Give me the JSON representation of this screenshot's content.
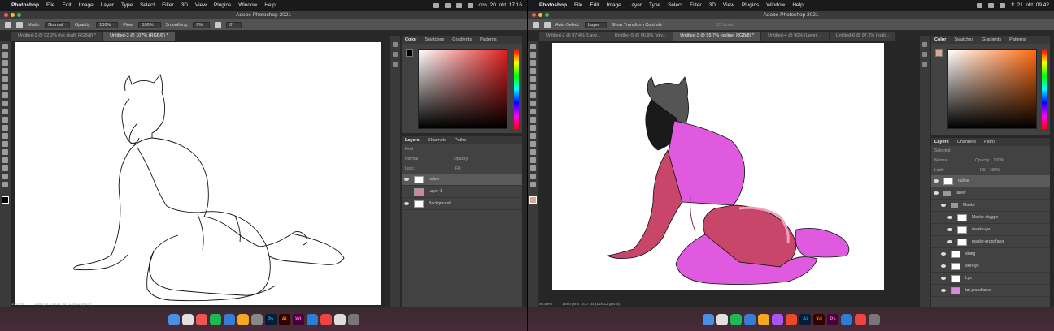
{
  "menu_left": {
    "app": "Photoshop",
    "items": [
      "File",
      "Edit",
      "Image",
      "Layer",
      "Type",
      "Select",
      "Filter",
      "3D",
      "View",
      "Plugins",
      "Window",
      "Help"
    ],
    "clock": "ons. 20. okt. 17.16"
  },
  "menu_right": {
    "app": "Photoshop",
    "items": [
      "File",
      "Edit",
      "Image",
      "Layer",
      "Type",
      "Select",
      "Filter",
      "3D",
      "View",
      "Plugins",
      "Window",
      "Help"
    ],
    "clock": "fr. 21. okt. 09.42"
  },
  "title_left": "Adobe Photoshop 2021",
  "title_right": "Adobe Photoshop 2021",
  "opts_left": {
    "mode_label": "Mode:",
    "mode": "Normal",
    "opacity_label": "Opacity:",
    "opacity": "100%",
    "flow_label": "Flow:",
    "flow": "100%",
    "smoothing_label": "Smoothing:",
    "smoothing": "0%",
    "angle": "0°"
  },
  "opts_right": {
    "auto_select": "Auto-Select:",
    "layer": "Layer",
    "transform": "Show Transform Controls",
    "mode3d": "3D Mode:"
  },
  "tabs_left": [
    "Untitled-2 @ 92,2% (lys skaft, RGB/8) *",
    "Untitled-3 @ 107% (RGB/8) *"
  ],
  "tabs_right": [
    "Untitled-2 @ 97,4% (Laye...",
    "Untitled-5 @ 90,9% (sky...",
    "Untitled-3 @ 95,7% (ouline, RGB/8) *",
    "Untitled-4 @ 90% (Layer ...",
    "Untitled-6 @ 97,2% (outli..."
  ],
  "status_left": {
    "zoom": "106,6%",
    "size": "1690 px x 1417 px (118,11 ppcm)"
  },
  "status_right": {
    "zoom": "95,69%",
    "size": "1690 px x 1417 px (118,11 ppcm)"
  },
  "color_tabs": [
    "Color",
    "Swatches",
    "Gradients",
    "Patterns"
  ],
  "layer_tabs": [
    "Layers",
    "Channels",
    "Paths"
  ],
  "layers_left": {
    "kind": "Kind",
    "blend": "Normal",
    "opacity": "Opacity:",
    "lock": "Lock:",
    "fill": "Fill:",
    "items": [
      {
        "name": "ouline",
        "sel": true
      },
      {
        "name": "Layer 1",
        "sel": false
      },
      {
        "name": "Background",
        "sel": false
      }
    ]
  },
  "layers_right": {
    "kind": "Selected",
    "blend": "Normal",
    "opacity_label": "Opacity:",
    "opacity": "100%",
    "lock": "Lock:",
    "fill_label": "Fill:",
    "fill": "100%",
    "items": [
      {
        "name": "ouline",
        "sel": true
      },
      {
        "name": "farver",
        "sel": false
      },
      {
        "name": "Maske",
        "sel": false
      },
      {
        "name": "Maske-skygge",
        "sel": false
      },
      {
        "name": "maske-lys",
        "sel": false
      },
      {
        "name": "maske-grundfarve",
        "sel": false
      },
      {
        "name": "skæg",
        "sel": false
      },
      {
        "name": "skin-lys",
        "sel": false
      },
      {
        "name": "Lys",
        "sel": false
      },
      {
        "name": "tøj-grundfarve",
        "sel": false
      }
    ]
  },
  "dock_text": [
    "Ps",
    "Ai",
    "Xd",
    "Ai",
    "Xd",
    "Ps"
  ],
  "colors": {
    "accent": "#e34a2b",
    "skin": "#c8466a",
    "suit": "#dd55dd",
    "hair": "#222222"
  }
}
